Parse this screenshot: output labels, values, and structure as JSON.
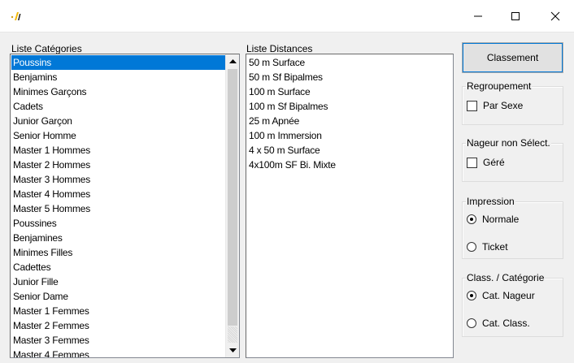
{
  "window": {
    "icon": "app-logo-icon",
    "controls": {
      "minimize": "minimize-icon",
      "maximize": "maximize-icon",
      "close": "close-icon"
    }
  },
  "categories": {
    "label": "Liste Catégories",
    "items": [
      "Poussins",
      "Benjamins",
      "Minimes Garçons",
      "Cadets",
      "Junior Garçon",
      "Senior Homme",
      "Master 1 Hommes",
      "Master 2 Hommes",
      "Master 3 Hommes",
      "Master 4 Hommes",
      "Master 5 Hommes",
      "Poussines",
      "Benjamines",
      "Minimes Filles",
      "Cadettes",
      "Junior Fille",
      "Senior Dame",
      "Master 1 Femmes",
      "Master 2 Femmes",
      "Master 3 Femmes",
      "Master 4 Femmes"
    ],
    "selected": "Poussins"
  },
  "distances": {
    "label": "Liste Distances",
    "items": [
      "50 m Surface",
      "50 m Sf Bipalmes",
      "100 m Surface",
      "100 m Sf Bipalmes",
      "25 m Apnée",
      "100 m Immersion",
      "4 x 50 m Surface",
      "4x100m SF Bi. Mixte"
    ]
  },
  "classement_button": "Classement",
  "regroupement": {
    "title": "Regroupement",
    "option": "Par Sexe",
    "checked": false
  },
  "nageur": {
    "title": "Nageur non Sélect.",
    "option": "Géré",
    "checked": false
  },
  "impression": {
    "title": "Impression",
    "options": [
      "Normale",
      "Ticket"
    ],
    "selected": "Normale"
  },
  "class_categorie": {
    "title": "Class. / Catégorie",
    "options": [
      "Cat. Nageur",
      "Cat. Class."
    ],
    "selected": "Cat. Nageur"
  },
  "colors": {
    "selection": "#0078d7",
    "window_bg": "#f0f0f0"
  }
}
